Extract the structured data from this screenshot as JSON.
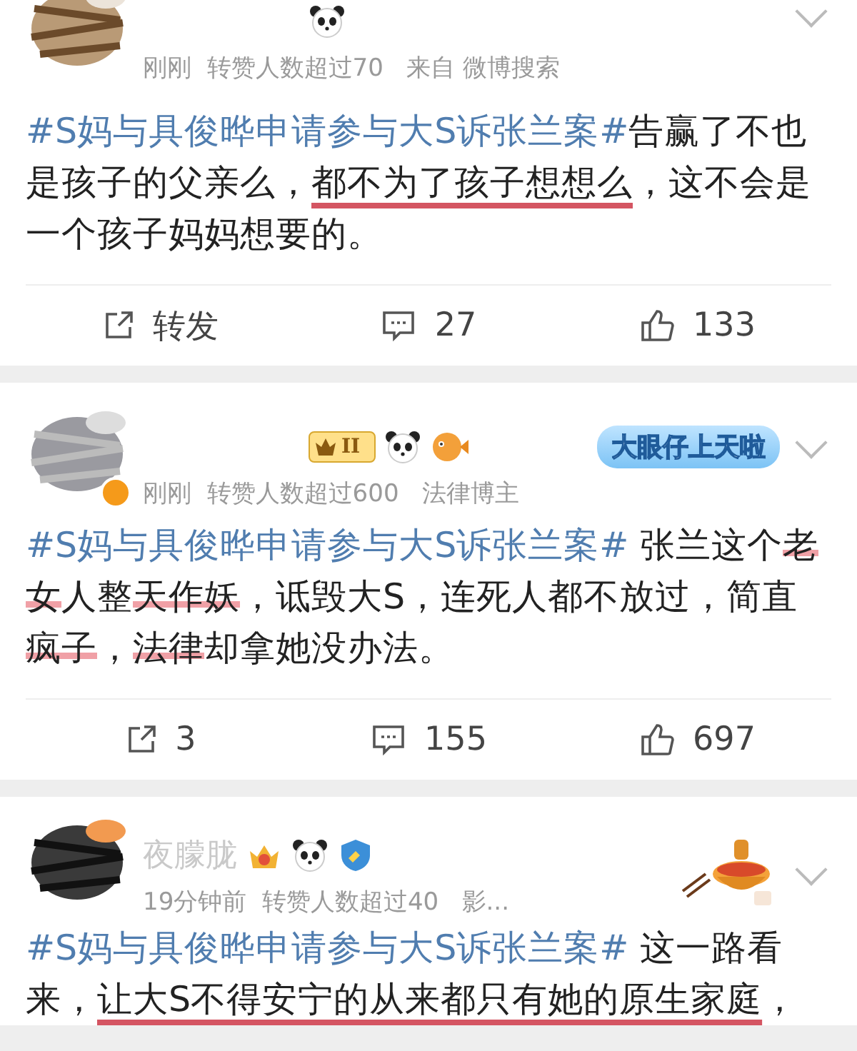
{
  "posts": [
    {
      "badges": [
        {
          "kind": "panda"
        }
      ],
      "meta": "刚刚  转赞人数超过70   来自 微博搜索",
      "body": [
        {
          "kind": "hashtag",
          "text": "#S妈与具俊晔申请参与大S诉张兰案#"
        },
        {
          "kind": "plain",
          "text": "告赢了不也是孩子的父亲么，"
        },
        {
          "kind": "underlined",
          "text": "都不为了孩子想想么"
        },
        {
          "kind": "plain",
          "text": "，这不会是一个孩子妈妈想要的。"
        }
      ],
      "actions": {
        "repost": "转发",
        "comment": "27",
        "like": "133"
      }
    },
    {
      "verified": true,
      "badges": [
        {
          "kind": "crown"
        },
        {
          "kind": "panda"
        },
        {
          "kind": "puffer"
        }
      ],
      "crown_level": "II",
      "sticker": {
        "kind": "banner",
        "text": "大眼仔上天啦"
      },
      "meta": "刚刚  转赞人数超过600   法律博主",
      "body": [
        {
          "kind": "hashtag",
          "text": "#S妈与具俊晔申请参与大S诉张兰案#"
        },
        {
          "kind": "plain",
          "text": " 张兰这个"
        },
        {
          "kind": "struck",
          "text": "老女"
        },
        {
          "kind": "plain",
          "text": "人整"
        },
        {
          "kind": "struck",
          "text": "天作妖"
        },
        {
          "kind": "plain",
          "text": "，诋毁大S，连死人都不放过，简直"
        },
        {
          "kind": "struck",
          "text": "疯子"
        },
        {
          "kind": "plain",
          "text": "，"
        },
        {
          "kind": "struck",
          "text": "法律"
        },
        {
          "kind": "plain",
          "text": "却拿她没办法。"
        }
      ],
      "actions": {
        "repost": "3",
        "comment": "155",
        "like": "697"
      }
    },
    {
      "name": "夜朦胧",
      "badges": [
        {
          "kind": "medal"
        },
        {
          "kind": "panda"
        },
        {
          "kind": "shield"
        }
      ],
      "sticker": {
        "kind": "hotpot"
      },
      "meta": "19分钟前  转赞人数超过40   影...",
      "body": [
        {
          "kind": "hashtag",
          "text": "#S妈与具俊晔申请参与大S诉张兰案#"
        },
        {
          "kind": "plain",
          "text": " 这一路看来，"
        },
        {
          "kind": "underlined",
          "text": "让大S不得安宁的从来都只有她的原生家庭"
        },
        {
          "kind": "plain",
          "text": "，"
        }
      ]
    }
  ]
}
